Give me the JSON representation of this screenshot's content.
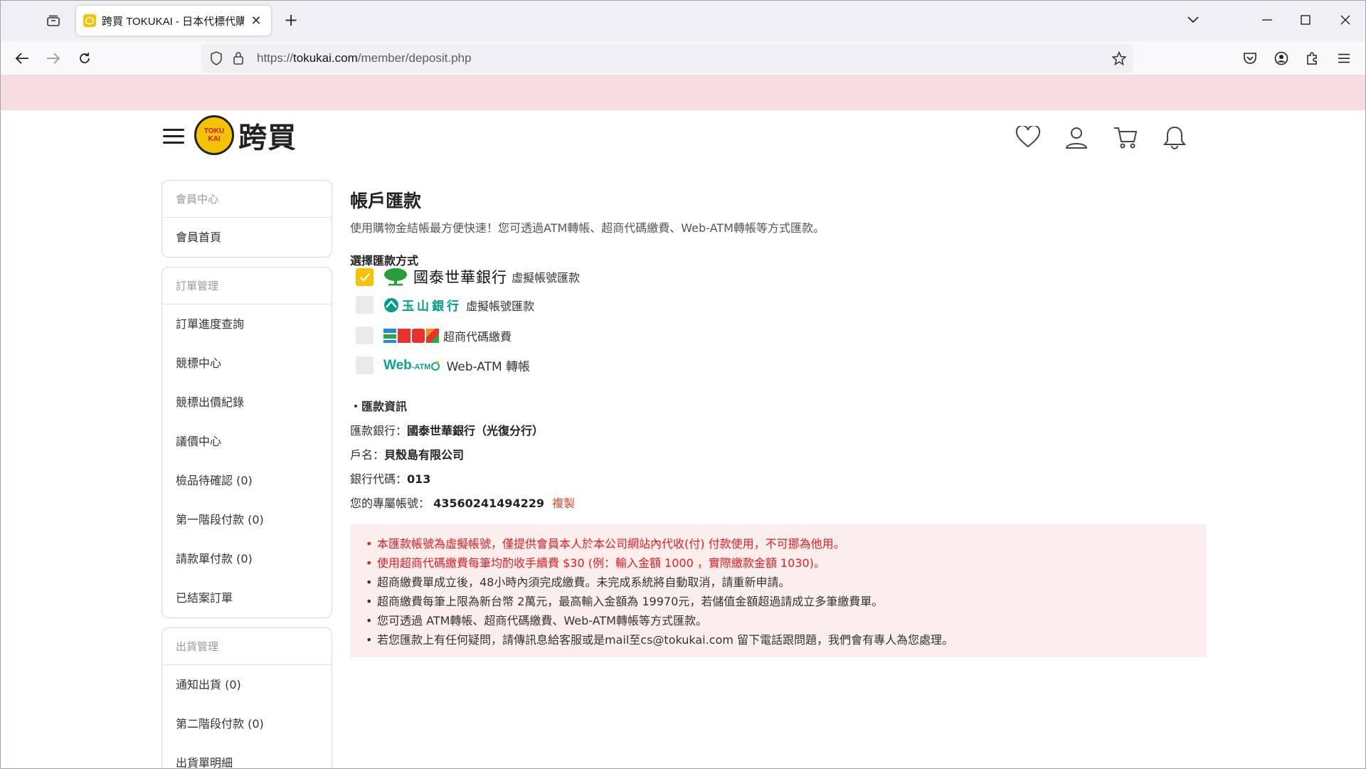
{
  "browser": {
    "tab_title": "跨買 TOKUKAI - 日本代標代購",
    "url_prefix": "https://",
    "url_domain": "tokukai.com",
    "url_path": "/member/deposit.php"
  },
  "site": {
    "logo_badge_top": "TOKU",
    "logo_badge_bottom": "KAI",
    "logo_text": "跨買"
  },
  "sidebar": {
    "groups": [
      {
        "heading": "會員中心",
        "items": [
          "會員首頁"
        ]
      },
      {
        "heading": "訂單管理",
        "items": [
          "訂單進度查詢",
          "競標中心",
          "競標出價紀錄",
          "議價中心",
          "檢品待確認 (0)",
          "第一階段付款 (0)",
          "請款單付款 (0)",
          "已結案訂單"
        ]
      },
      {
        "heading": "出貨管理",
        "items": [
          "通知出貨 (0)",
          "第二階段付款 (0)",
          "出貨單明細"
        ]
      }
    ]
  },
  "main": {
    "title": "帳戶匯款",
    "subtitle": "使用購物金結帳最方便快速！您可透過ATM轉帳、超商代碼繳費、Web-ATM轉帳等方式匯款。",
    "method_label": "選擇匯款方式",
    "methods": {
      "cathay_name": "國泰世華銀行",
      "cathay_note": "虛擬帳號匯款",
      "esun_name": "玉山銀行",
      "esun_note": "虛擬帳號匯款",
      "store_note": "超商代碼繳費",
      "webatm_logo": "Web",
      "webatm_logo_small": "-ATM",
      "webatm_note": "Web-ATM 轉帳"
    },
    "info_heading": "・匯款資訊",
    "bank_label": "匯款銀行：",
    "bank_value": "國泰世華銀行（光復分行）",
    "account_name_label": "戶名：",
    "account_name_value": "貝殼島有限公司",
    "bank_code_label": "銀行代碼：",
    "bank_code_value": "013",
    "account_no_label": "您的專屬帳號：",
    "account_no_value": "43560241494229",
    "copy_label": "複製",
    "notices": [
      "本匯款帳號為虛擬帳號，僅提供會員本人於本公司網站內代收(付) 付款使用，不可挪為他用。",
      "使用超商代碼繳費每筆均酌收手續費 $30 (例：輸入金額 1000 ，實際繳款金額 1030)。",
      "超商繳費單成立後，48小時內須完成繳費。未完成系統將自動取消，請重新申請。",
      "超商繳費每筆上限為新台幣 2萬元，最高輸入金額為 19970元，若儲值金額超過請成立多筆繳費單。",
      "您可透過 ATM轉帳、超商代碼繳費、Web-ATM轉帳等方式匯款。",
      "若您匯款上有任何疑問，請傳訊息給客服或是mail至cs@tokukai.com 留下電話跟問題，我們會有專人為您處理。"
    ]
  },
  "colors": {
    "brand_yellow": "#f6c300",
    "banner_pink": "#f7dde1",
    "notice_red": "#e51c23",
    "copy_orange": "#e8452c"
  }
}
